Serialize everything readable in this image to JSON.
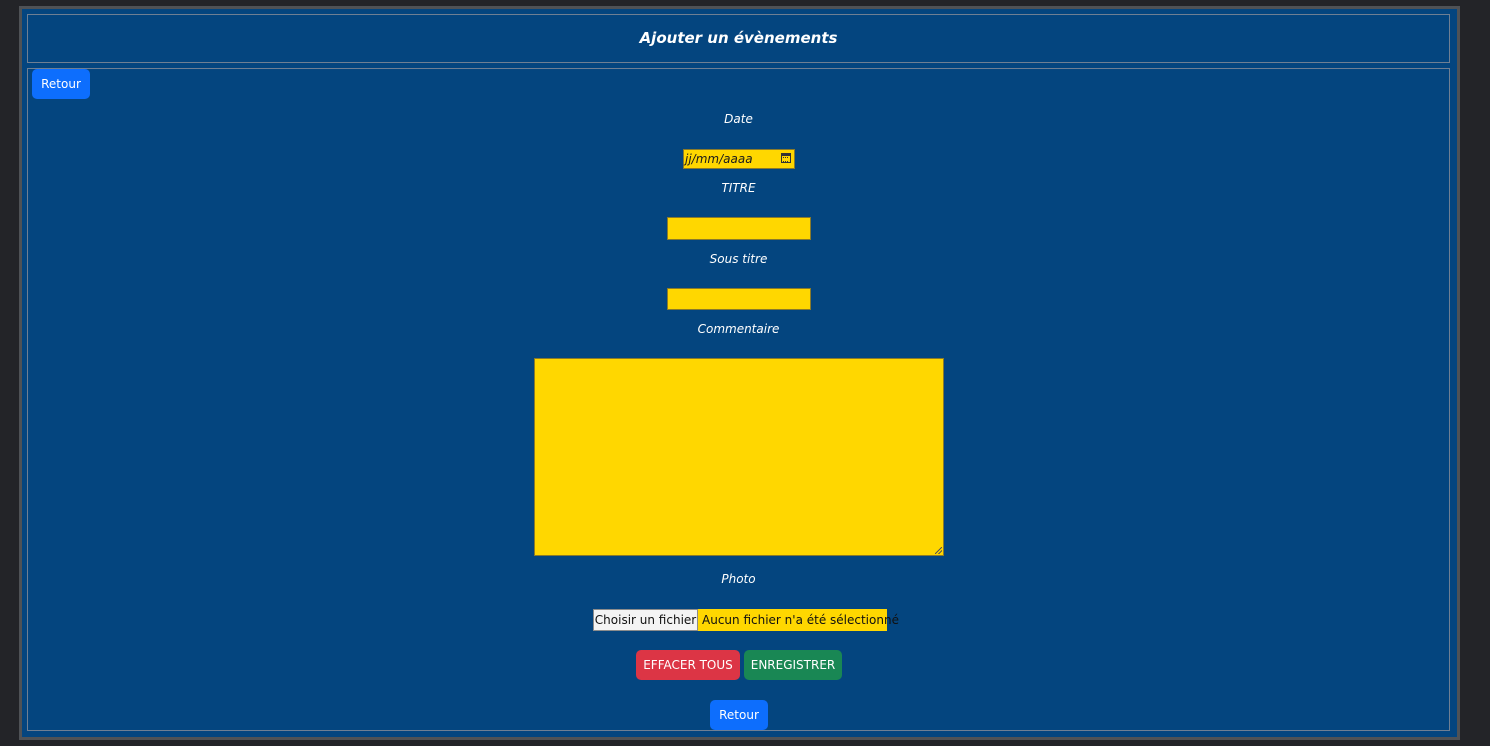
{
  "header": {
    "title": "Ajouter un évènements"
  },
  "nav": {
    "back_top_label": "Retour",
    "back_bottom_label": "Retour"
  },
  "form": {
    "date": {
      "label": "Date",
      "placeholder": "jj/mm/aaaa",
      "icon": "calendar-icon"
    },
    "titre": {
      "label": "TITRE",
      "value": ""
    },
    "sous_titre": {
      "label": "Sous titre",
      "value": ""
    },
    "commentaire": {
      "label": "Commentaire",
      "value": ""
    },
    "photo": {
      "label": "Photo",
      "button_label": "Choisir un fichier",
      "status": "Aucun fichier n'a été sélectionné"
    }
  },
  "actions": {
    "clear_label": "EFFACER TOUS",
    "save_label": "ENREGISTRER"
  },
  "colors": {
    "background": "#04457f",
    "field": "#ffd700",
    "primary": "#0d6efd",
    "danger": "#dc3545",
    "success": "#198754"
  }
}
